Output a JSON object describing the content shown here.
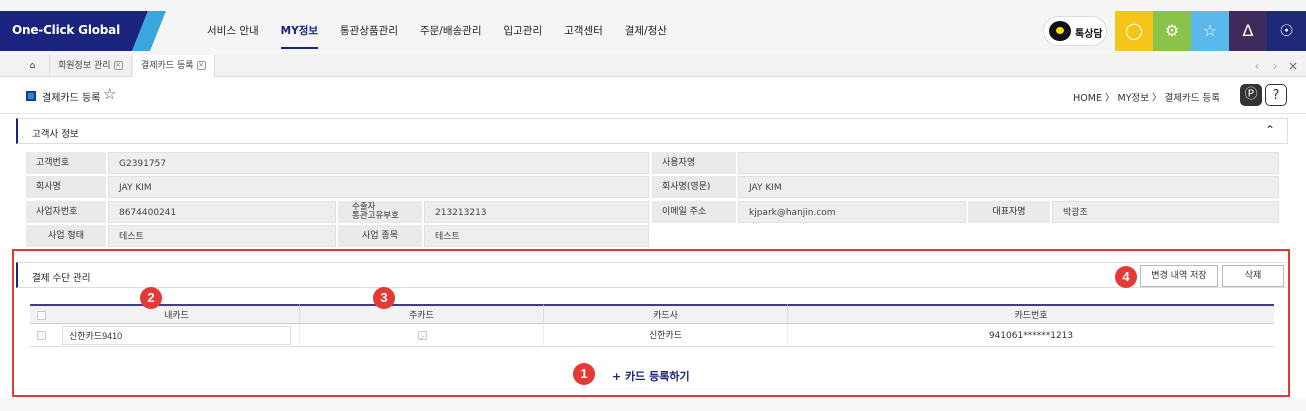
{
  "app": {
    "logo": "One-Click Global"
  },
  "nav": {
    "items": [
      "서비스 안내",
      "MY정보",
      "통관상품관리",
      "주문/배송관리",
      "입고관리",
      "고객센터",
      "결제/정산"
    ],
    "talk_label": "톡상담"
  },
  "colors": {
    "brand_navy": "#1a237e",
    "search_btn": "#f5c518",
    "settings_btn": "#8bc34a",
    "favorite_btn": "#5ab9ea",
    "alarm_btn": "#3e2a5c",
    "user_btn": "#1e2a78",
    "highlight_red": "#e53935"
  },
  "tabs": {
    "home_icon": "home-icon",
    "items": [
      "회원정보 관리",
      "결제카드 등록"
    ]
  },
  "page": {
    "title": "결제카드 등록",
    "breadcrumb": "HOME 〉 MY정보 〉 결제카드 등록"
  },
  "customer_info": {
    "section_title": "고객사 정보",
    "customer_no_label": "고객번호",
    "customer_no": "G2391757",
    "user_name_label": "사용자명",
    "user_name": "",
    "company_label": "회사명",
    "company": "JAY KIM",
    "company_en_label": "회사명(영문)",
    "company_en": "JAY KIM",
    "biz_no_label": "사업자번호",
    "biz_no": "8674400241",
    "customs_label_1": "수출자",
    "customs_label_2": "통관고유부호",
    "customs_code": "213213213",
    "email_label": "이메일 주소",
    "email": "kjpark@hanjin.com",
    "ceo_label": "대표자명",
    "ceo": "박광조",
    "biz_type_label": "사업 형태",
    "biz_type": "테스트",
    "biz_item_label": "사업 종목",
    "biz_item": "테스트"
  },
  "payment": {
    "section_title": "결제 수단 관리",
    "save_label": "변경 내역 저장",
    "delete_label": "삭제",
    "columns": [
      "내카드",
      "주카드",
      "카드사",
      "카드번호"
    ],
    "rows": [
      {
        "my_card": "신한카드9410",
        "is_main": true,
        "issuer": "신한카드",
        "card_no": "941061******1213"
      }
    ],
    "add_card_label": "+ 카드 등록하기"
  },
  "annotations": [
    "1",
    "2",
    "3",
    "4"
  ]
}
